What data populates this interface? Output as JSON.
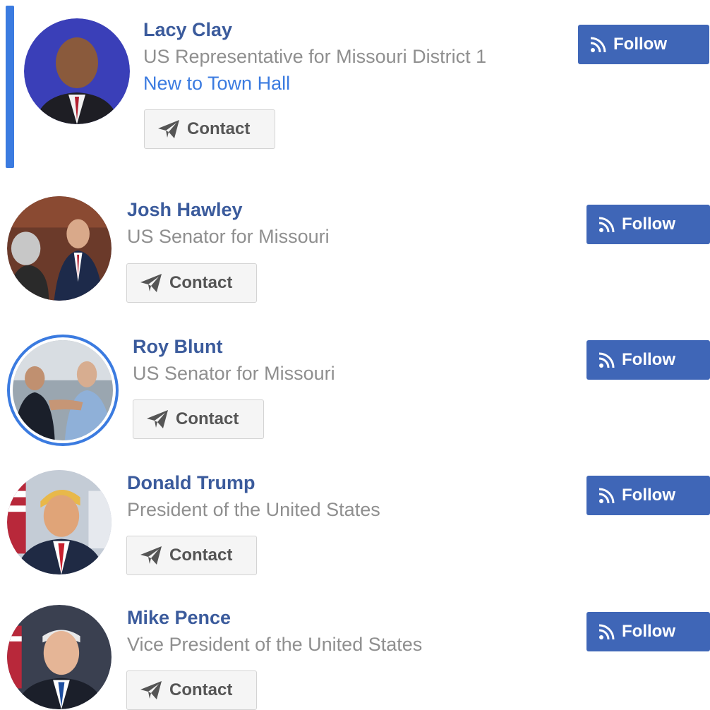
{
  "representatives": [
    {
      "name": "Lacy Clay",
      "title": "US Representative for Missouri District 1",
      "tag": "New to Town Hall",
      "contact_label": "Contact",
      "follow_label": "Follow"
    },
    {
      "name": "Josh Hawley",
      "title": "US Senator for Missouri",
      "contact_label": "Contact",
      "follow_label": "Follow"
    },
    {
      "name": "Roy Blunt",
      "title": "US Senator for Missouri",
      "contact_label": "Contact",
      "follow_label": "Follow"
    },
    {
      "name": "Donald Trump",
      "title": "President of the United States",
      "contact_label": "Contact",
      "follow_label": "Follow"
    },
    {
      "name": "Mike Pence",
      "title": "Vice President of the United States",
      "contact_label": "Contact",
      "follow_label": "Follow"
    }
  ],
  "icons": {
    "contact": "paper-plane-icon",
    "follow": "rss-feed-icon"
  },
  "colors": {
    "accent": "#3b7be0",
    "name": "#3b5b9c",
    "follow_bg": "#3f66b7",
    "muted": "#8f8f8f"
  }
}
